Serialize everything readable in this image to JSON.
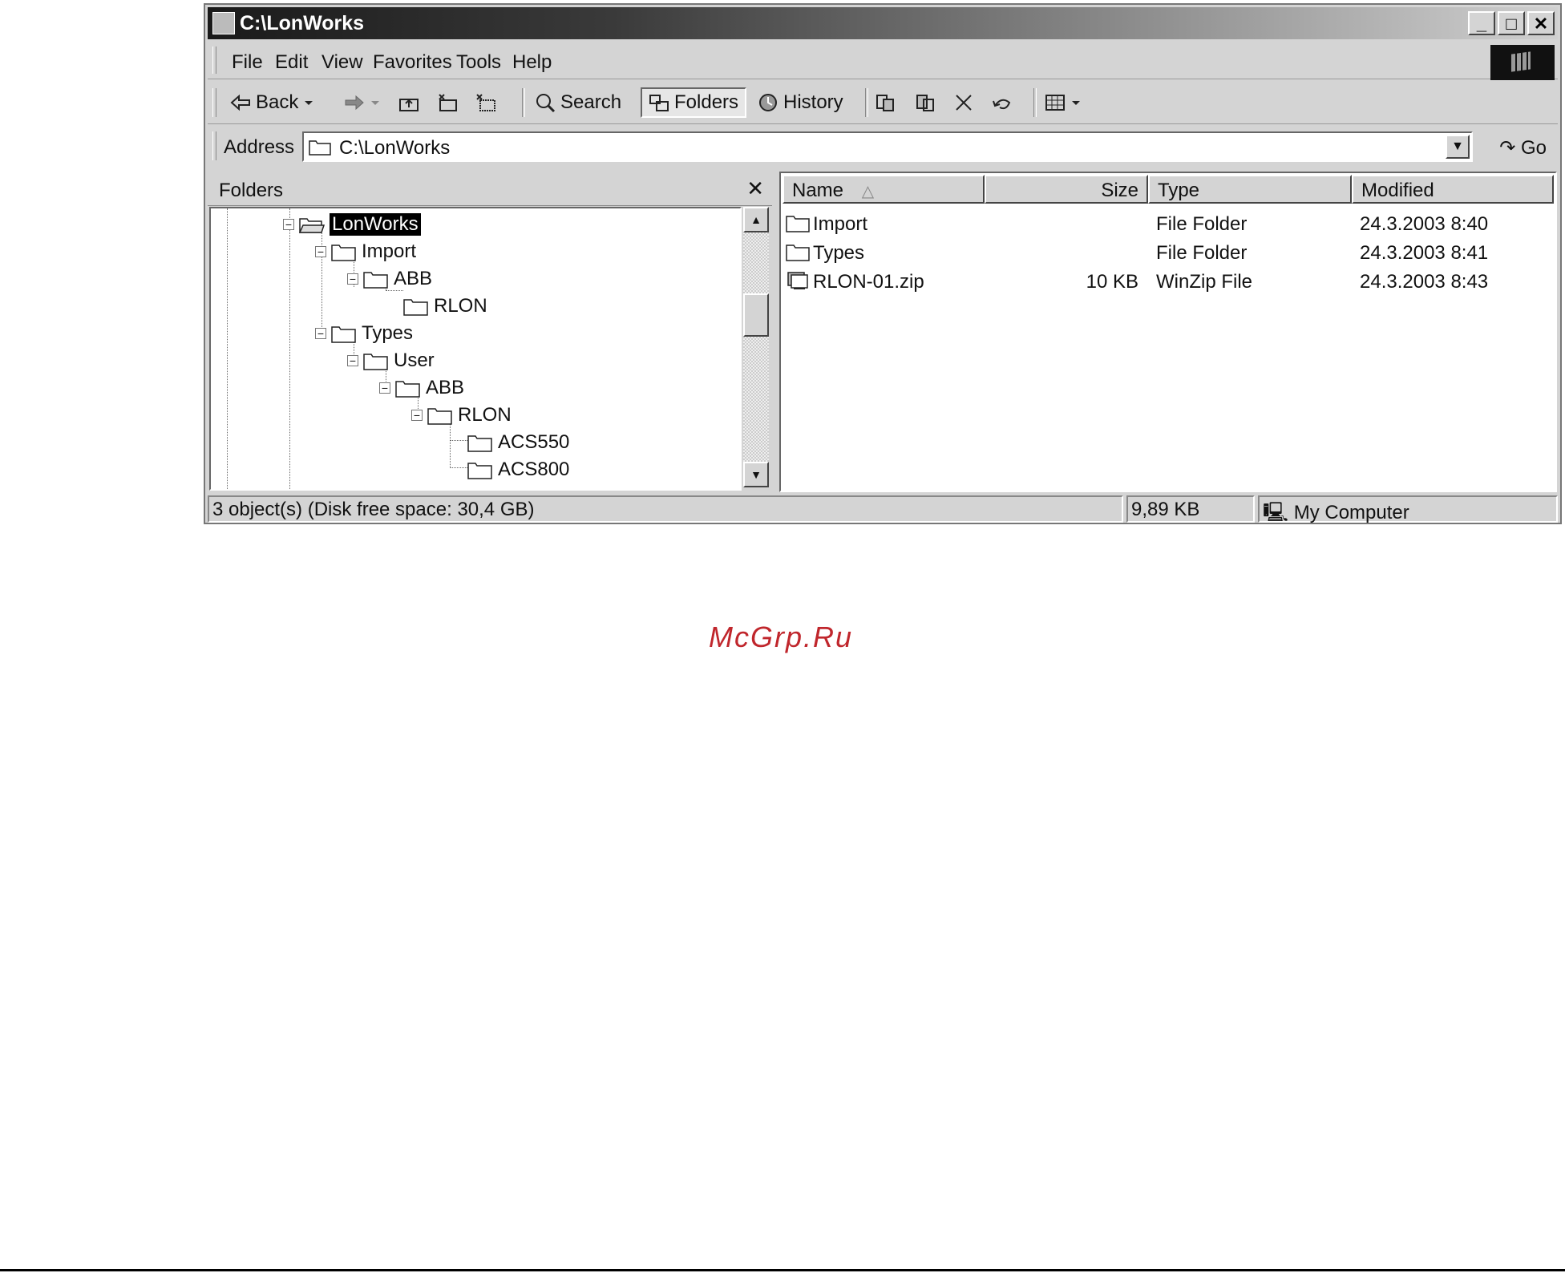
{
  "window": {
    "title": "C:\\LonWorks",
    "controls": {
      "minimize": "_",
      "maximize": "□",
      "close": "✕"
    }
  },
  "menubar": {
    "items": [
      "File",
      "Edit",
      "View",
      "Favorites",
      "Tools",
      "Help"
    ]
  },
  "toolbar": {
    "back_label": "Back",
    "search_label": "Search",
    "folders_label": "Folders",
    "history_label": "History"
  },
  "address": {
    "label": "Address",
    "value": "C:\\LonWorks",
    "go_label": "Go"
  },
  "folders_pane": {
    "title": "Folders",
    "close_glyph": "✕",
    "tree": [
      {
        "label": "LonWorks",
        "selected": true
      },
      {
        "label": "Import"
      },
      {
        "label": "ABB"
      },
      {
        "label": "RLON"
      },
      {
        "label": "Types"
      },
      {
        "label": "User"
      },
      {
        "label": "ABB"
      },
      {
        "label": "RLON"
      },
      {
        "label": "ACS550"
      },
      {
        "label": "ACS800"
      }
    ]
  },
  "file_list": {
    "columns": [
      "Name",
      "Size",
      "Type",
      "Modified"
    ],
    "sort_indicator": "△",
    "rows": [
      {
        "name": "Import",
        "size": "",
        "type": "File Folder",
        "modified": "24.3.2003 8:40",
        "icon": "folder-icon"
      },
      {
        "name": "Types",
        "size": "",
        "type": "File Folder",
        "modified": "24.3.2003 8:41",
        "icon": "folder-icon"
      },
      {
        "name": "RLON-01.zip",
        "size": "10 KB",
        "type": "WinZip File",
        "modified": "24.3.2003 8:43",
        "icon": "winzip-icon"
      }
    ]
  },
  "statusbar": {
    "objects": "3 object(s) (Disk free space: 30,4 GB)",
    "size": "9,89 KB",
    "zone": "My Computer"
  },
  "watermark": "McGrp.Ru"
}
